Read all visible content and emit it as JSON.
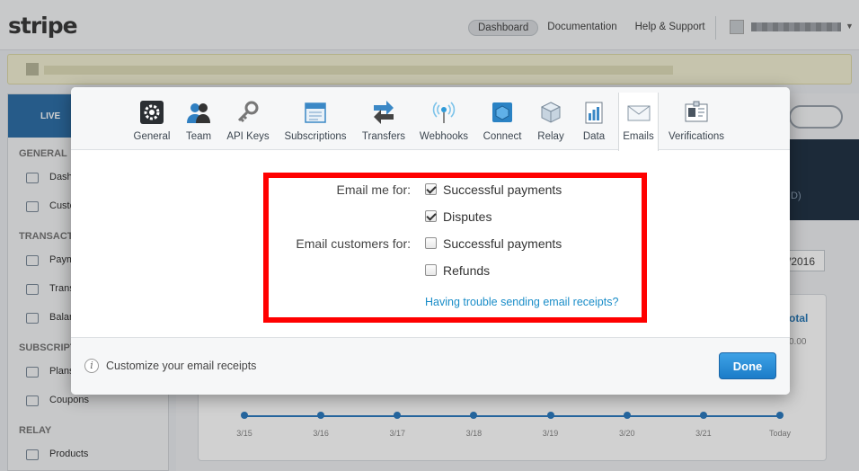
{
  "app": {
    "logo": "stripe",
    "nav": {
      "dashboard": "Dashboard",
      "documentation": "Documentation",
      "help": "Help & Support"
    }
  },
  "sidebar": {
    "live_label": "LIVE",
    "sections": [
      {
        "title": "GENERAL",
        "items": [
          "Dash",
          "Custo"
        ]
      },
      {
        "title": "TRANSACT",
        "items": [
          "Paym",
          "Trans",
          "Balan"
        ]
      },
      {
        "title": "SUBSCRIPT",
        "items": [
          "Plans",
          "Coupons"
        ]
      },
      {
        "title": "RELAY",
        "items": [
          "Products"
        ]
      }
    ]
  },
  "background": {
    "panel_suffix": "D)",
    "date_value": "/2016",
    "total_label": "otal",
    "total_value": "0.00",
    "chart_ticks": [
      "3/15",
      "3/16",
      "3/17",
      "3/18",
      "3/19",
      "3/20",
      "3/21",
      "Today"
    ]
  },
  "modal": {
    "tabs": [
      {
        "label": "General",
        "icon": "gear-icon"
      },
      {
        "label": "Team",
        "icon": "team-icon"
      },
      {
        "label": "API Keys",
        "icon": "key-icon"
      },
      {
        "label": "Subscriptions",
        "icon": "calendar-icon"
      },
      {
        "label": "Transfers",
        "icon": "transfer-arrows-icon"
      },
      {
        "label": "Webhooks",
        "icon": "broadcast-icon"
      },
      {
        "label": "Connect",
        "icon": "cube-icon"
      },
      {
        "label": "Relay",
        "icon": "box-icon"
      },
      {
        "label": "Data",
        "icon": "data-icon"
      },
      {
        "label": "Emails",
        "icon": "envelope-icon",
        "active": true
      },
      {
        "label": "Verifications",
        "icon": "id-card-icon"
      }
    ],
    "email_me": {
      "label": "Email me for:",
      "options": [
        {
          "label": "Successful payments",
          "checked": true
        },
        {
          "label": "Disputes",
          "checked": true
        }
      ]
    },
    "email_customers": {
      "label": "Email customers for:",
      "options": [
        {
          "label": "Successful payments",
          "checked": false
        },
        {
          "label": "Refunds",
          "checked": false
        }
      ]
    },
    "help_link": "Having trouble sending email receipts?",
    "footer_text": "Customize your email receipts",
    "done_label": "Done"
  },
  "colors": {
    "accent": "#1b7cc8",
    "highlight": "#ff0000",
    "link": "#1a8dc8"
  }
}
